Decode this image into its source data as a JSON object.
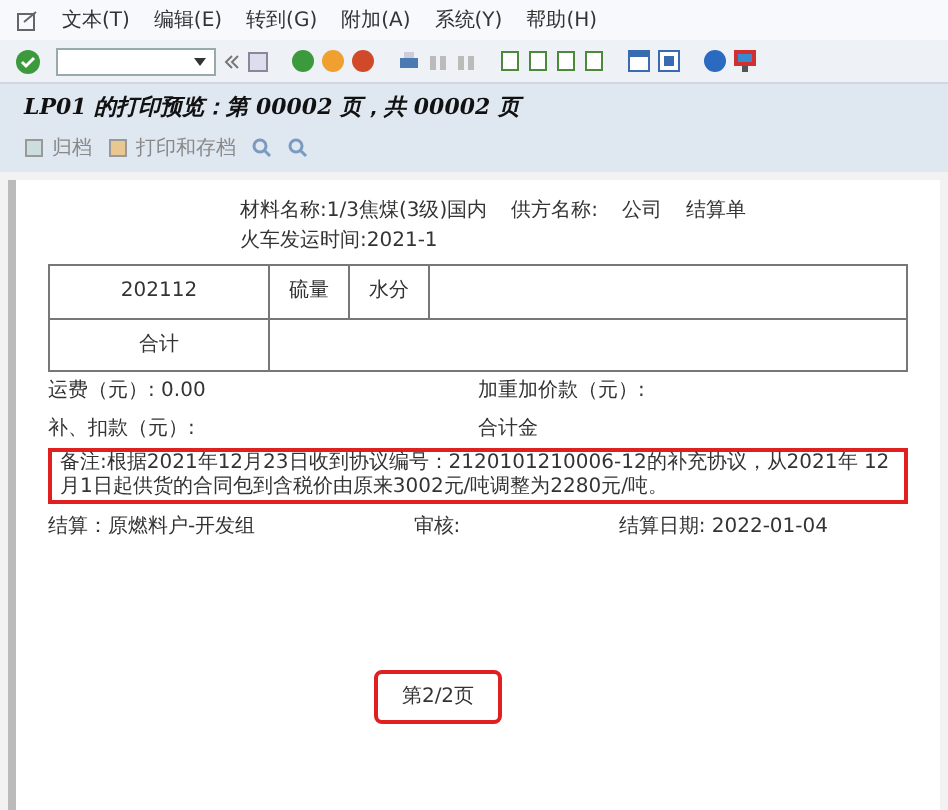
{
  "menu": [
    "文本(T)",
    "编辑(E)",
    "转到(G)",
    "附加(A)",
    "系统(Y)",
    "帮助(H)"
  ],
  "title": "LP01 的打印预览：第 00002 页，共 00002  页",
  "app_toolbar": [
    "归档",
    "打印和存档"
  ],
  "document": {
    "header": [
      "材料名称:1/3焦煤(3级)国内",
      "供方名称:",
      "公司",
      "结算单",
      "火车发运时间:2021-1"
    ],
    "table_rows": [
      {
        "cells": [
          "202112",
          "硫量",
          "水分"
        ]
      },
      {
        "cells": [
          "合计"
        ]
      }
    ],
    "fields": [
      "运费（元）: 0.00",
      "加重加价款（元）:",
      "补、扣款（元）:",
      "合计金"
    ],
    "remark": "备注:根据2021年12月23日收到协议编号：2120101210006-12的补充协议，从2021年 12月1日起供货的合同包到含税价由原来3002元/吨调整为2280元/吨。",
    "footer": [
      "结算：原燃料户-开发组",
      "审核:",
      "结算日期: 2022-01-04"
    ],
    "page_label": "第2/2页"
  }
}
